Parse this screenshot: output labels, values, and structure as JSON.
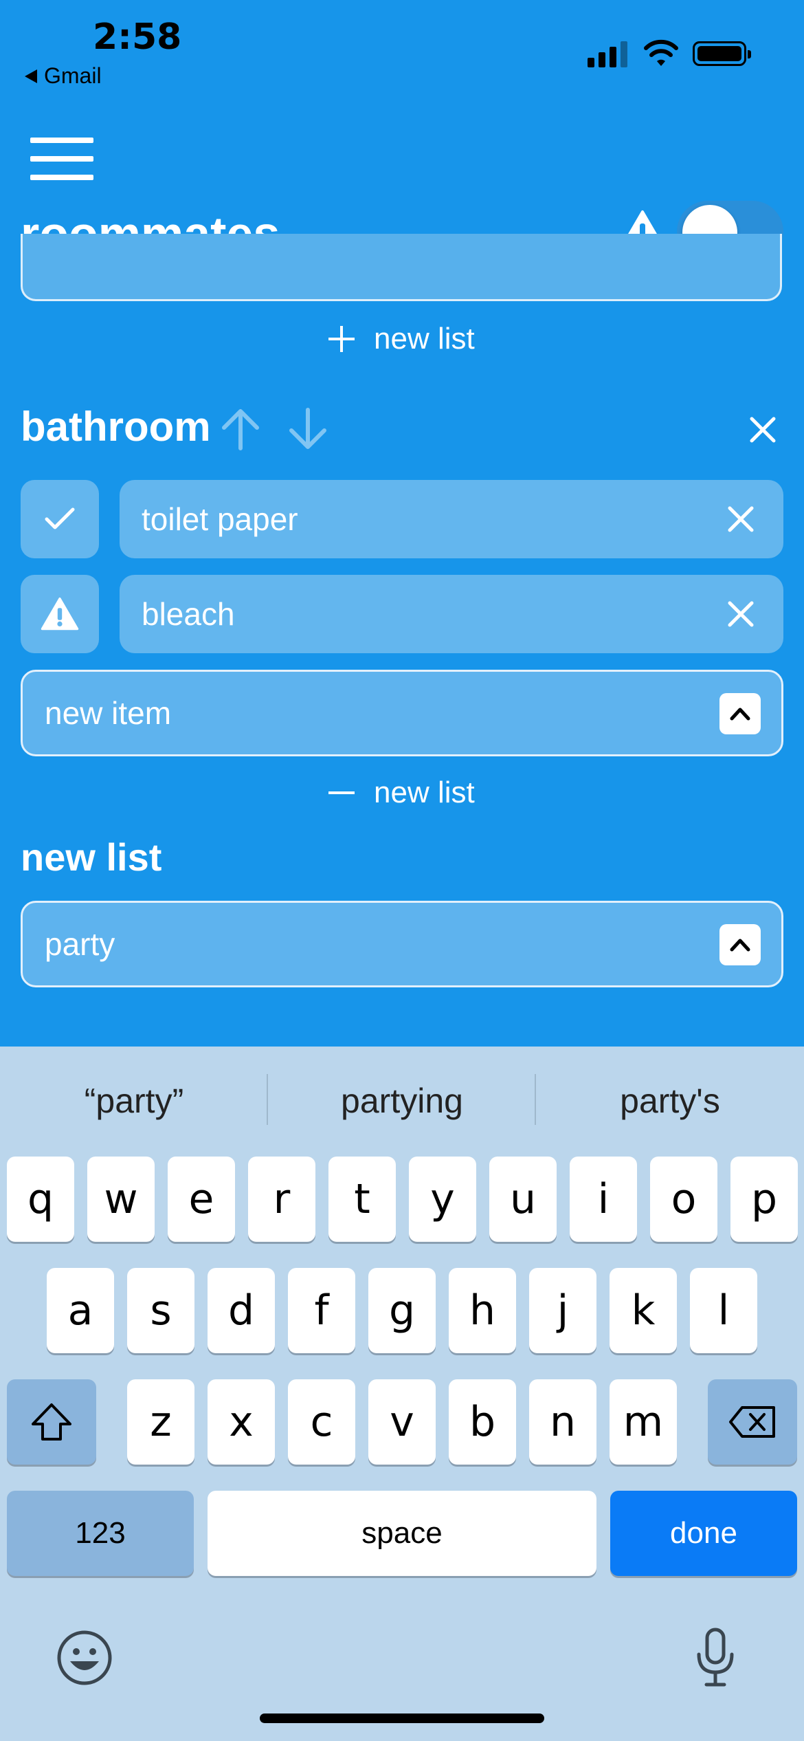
{
  "status": {
    "time": "2:58",
    "back_label": "Gmail"
  },
  "header": {
    "title": "roommates",
    "menu_icon": "hamburger-icon",
    "warning_icon": "warning-icon"
  },
  "lists": {
    "add_label_top": "new list",
    "bathroom": {
      "title": "bathroom",
      "items": [
        {
          "text": "toilet paper",
          "status": "checked"
        },
        {
          "text": "bleach",
          "status": "warning"
        }
      ],
      "new_item_placeholder": "new item"
    },
    "add_label_bottom": "new list"
  },
  "new_list": {
    "heading": "new list",
    "input_value": "party"
  },
  "keyboard": {
    "suggestions": [
      "“party”",
      "partying",
      "party's"
    ],
    "row1": [
      "q",
      "w",
      "e",
      "r",
      "t",
      "y",
      "u",
      "i",
      "o",
      "p"
    ],
    "row2": [
      "a",
      "s",
      "d",
      "f",
      "g",
      "h",
      "j",
      "k",
      "l"
    ],
    "row3": [
      "z",
      "x",
      "c",
      "v",
      "b",
      "n",
      "m"
    ],
    "numbers_label": "123",
    "space_label": "space",
    "done_label": "done"
  },
  "colors": {
    "background": "#1795ea",
    "accent": "#0a7bf6",
    "keyboard_bg": "#bbd6ec"
  }
}
